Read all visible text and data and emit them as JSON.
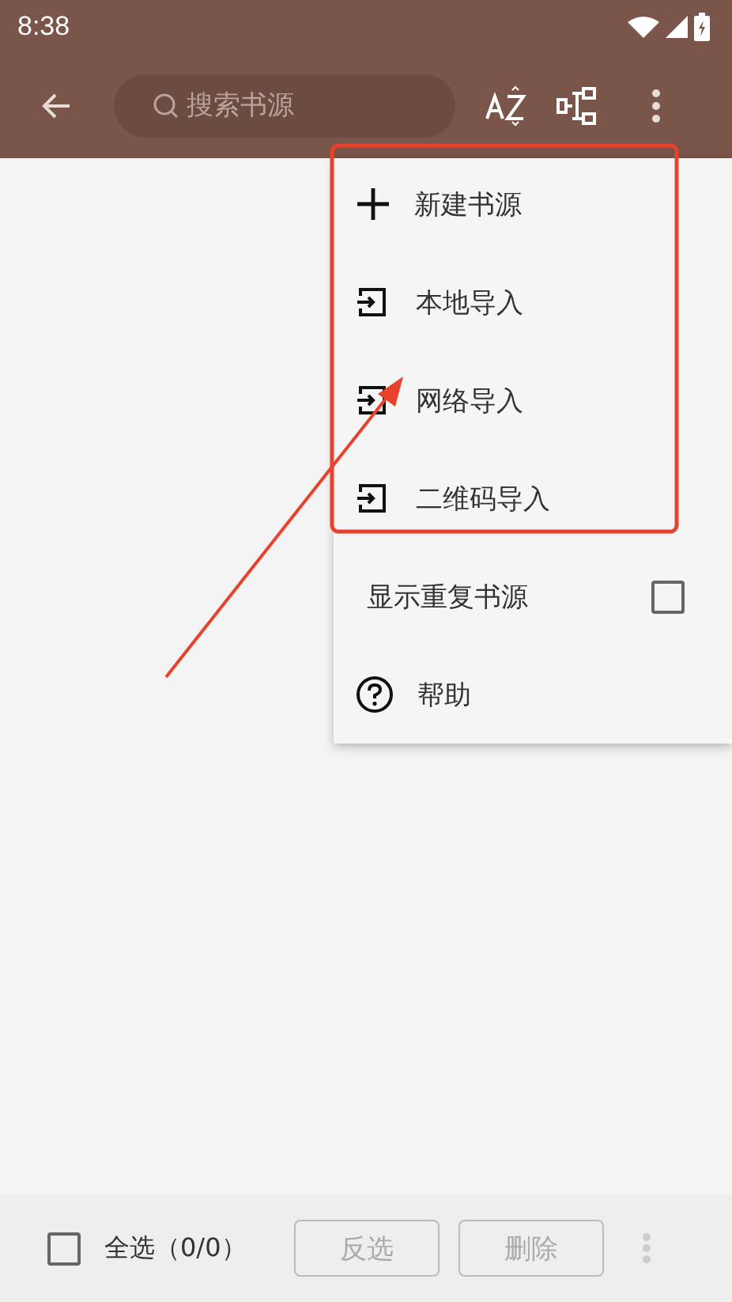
{
  "status_bar": {
    "time": "8:38"
  },
  "toolbar": {
    "search": {
      "placeholder": "搜索书源"
    }
  },
  "menu": [
    {
      "kind": "plus",
      "label": "新建书源"
    },
    {
      "kind": "import",
      "label": "本地导入"
    },
    {
      "kind": "import",
      "label": "网络导入"
    },
    {
      "kind": "import",
      "label": "二维码导入"
    },
    {
      "kind": "checkbox",
      "label": "显示重复书源",
      "checked": false
    },
    {
      "kind": "help",
      "label": "帮助"
    }
  ],
  "bottom_bar": {
    "select_all": {
      "label": "全选（0/0）",
      "checked": false
    },
    "buttons": [
      {
        "label": "反选",
        "disabled": true
      },
      {
        "label": "删除",
        "disabled": true
      }
    ]
  }
}
